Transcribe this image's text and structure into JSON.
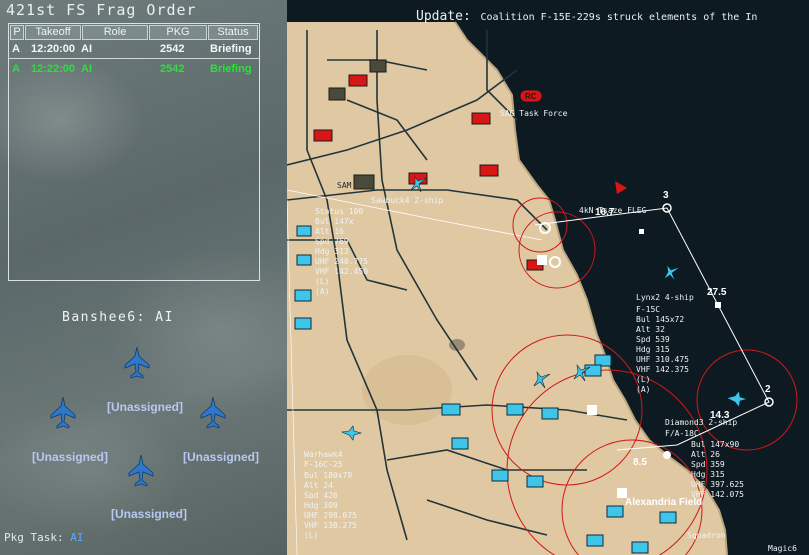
{
  "frag_order": {
    "title": "421st FS Frag Order",
    "columns": [
      "P",
      "Takeoff",
      "Role",
      "PKG",
      "Status"
    ],
    "rows": [
      {
        "p": "A",
        "takeoff": "12:20:00",
        "role": "AI",
        "pkg": "2542",
        "status": "Briefing"
      },
      {
        "p": "A",
        "takeoff": "12:22:00",
        "role": "AI",
        "pkg": "2542",
        "status": "Briefing"
      }
    ]
  },
  "flight": {
    "name": "Banshee6: AI",
    "slots": [
      "[Unassigned]",
      "[Unassigned]",
      "[Unassigned]",
      "[Unassigned]"
    ]
  },
  "package_task": {
    "label": "Pkg Task:",
    "value": "AI"
  },
  "map": {
    "update_label": "Update:",
    "update_text": "Coalition F-15E-229s struck elements of the In",
    "waypoints": [
      {
        "label": "3"
      },
      {
        "label": "27.5"
      },
      {
        "label": "2"
      },
      {
        "label": "16.7"
      },
      {
        "label": "14.3"
      },
      {
        "label": "8.5"
      }
    ],
    "labels": {
      "task_force": "SAG Task Force",
      "rc_badge": "RC",
      "sam": "SAM",
      "sawbuck": "Sawbuck4 2-ship",
      "lynx": "Lynx2 4-ship",
      "lynx_type": "F-15C",
      "diamond": "Diamond3 2-ship",
      "diamond_type": "F/A-18C",
      "warhawk": "Warhawk4",
      "warhawk_type": "F-16C-25",
      "ahkhan": "4kN Tsaze FLEG",
      "airbase": "Alexandria Field",
      "squadron": "Squadron",
      "magic": "Magic6"
    },
    "lynx_info": [
      "Bul 145x72",
      "Alt 32",
      "Spd 539",
      "Hdg 315",
      "UHF 310.475",
      "VHF 142.375",
      "(L)",
      "(A)"
    ],
    "diamond_info": [
      "Bul 147x90",
      "Alt 26",
      "Spd 359",
      "Hdg 315",
      "UHF 397.625",
      "VHF 142.075"
    ],
    "sawbuck_info": [
      "Status 100",
      "Bul 147x",
      "Alt 16",
      "Spd 769",
      "Hdg 313",
      "UHF 240.775",
      "VHF 142.450",
      "(L)",
      "(A)"
    ],
    "warhawk_info": [
      "Bul 180x79",
      "Alt 24",
      "Spd 426",
      "Hdg 309",
      "UHF 298.075",
      "VHF 138.275",
      "(L)"
    ],
    "colors": {
      "land": "#e0c9a2",
      "sea": "#0d1a22",
      "cyan_unit": "#3fc4ea",
      "red_unit": "#d81616",
      "route": "#ffffff",
      "threat_ring": "#d01818"
    }
  }
}
